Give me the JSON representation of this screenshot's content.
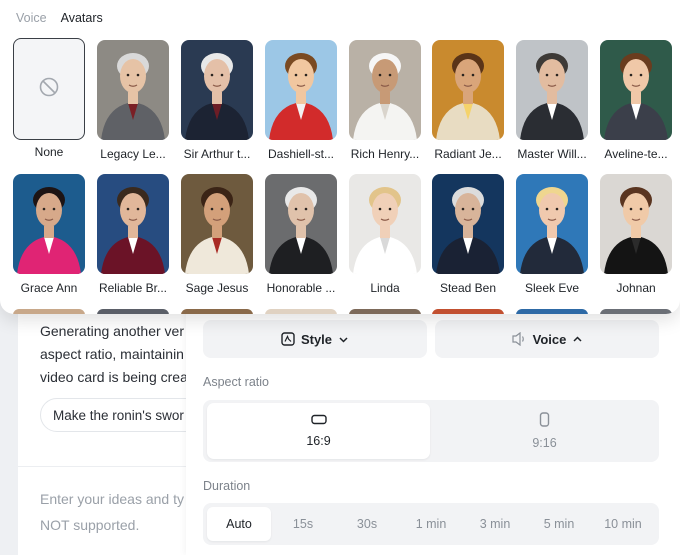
{
  "picker": {
    "tabs": [
      {
        "label": "Voice",
        "active": false
      },
      {
        "label": "Avatars",
        "active": true
      }
    ],
    "none_label": "None",
    "avatars_row1": [
      {
        "name": "Legacy Le...",
        "bg": "#8d8a84",
        "skin": "#e6c3a6",
        "hair": "#d9d9d9",
        "outfit": "#5f6166",
        "accent": "#7a1f25"
      },
      {
        "name": "Sir Arthur t...",
        "bg": "#2a3a52",
        "skin": "#e4c0a8",
        "hair": "#e8e8e8",
        "outfit": "#1c2333",
        "accent": "#6d1d26"
      },
      {
        "name": "Dashiell-st...",
        "bg": "#9cc7e6",
        "skin": "#f1c7a0",
        "hair": "#7a4a22",
        "outfit": "#d22b2b",
        "accent": "#f2f2f2"
      },
      {
        "name": "Rich Henry...",
        "bg": "#b9b1a6",
        "skin": "#c79a76",
        "hair": "#f6f6f6",
        "outfit": "#f4f4f2",
        "accent": "#d9d4cc"
      },
      {
        "name": "Radiant Je...",
        "bg": "#c98a2e",
        "skin": "#d9a57a",
        "hair": "#5a3418",
        "outfit": "#e8dcc2",
        "accent": "#f5d36b"
      },
      {
        "name": "Master Will...",
        "bg": "#bfc3c7",
        "skin": "#e2bca0",
        "hair": "#3d3a37",
        "outfit": "#2a2d33",
        "accent": "#ffffff"
      },
      {
        "name": "Aveline-te...",
        "bg": "#2f5a4a",
        "skin": "#f0c8a8",
        "hair": "#6a3c1e",
        "outfit": "#3b3f4a",
        "accent": "#ffffff"
      }
    ],
    "avatars_row2": [
      {
        "name": "Grace Ann",
        "bg": "#1d5c8e",
        "skin": "#d7a98a",
        "hair": "#1d1414",
        "outfit": "#e02474",
        "accent": "#ffffff"
      },
      {
        "name": "Reliable Br...",
        "bg": "#274c80",
        "skin": "#e1b79a",
        "hair": "#3a2a1e",
        "outfit": "#6b1327",
        "accent": "#ffffff"
      },
      {
        "name": "Sage Jesus",
        "bg": "#6e5a3e",
        "skin": "#d3a07a",
        "hair": "#3b2416",
        "outfit": "#efe8da",
        "accent": "#a82a24"
      },
      {
        "name": "Honorable ...",
        "bg": "#6b6c6e",
        "skin": "#e0c2ab",
        "hair": "#e9e9e9",
        "outfit": "#1e1f22",
        "accent": "#ffffff"
      },
      {
        "name": "Linda",
        "bg": "#e9e8e6",
        "skin": "#f0d0b8",
        "hair": "#e2c48a",
        "outfit": "#ffffff",
        "accent": "#d9d9d9"
      },
      {
        "name": "Stead Ben",
        "bg": "#14365e",
        "skin": "#d8b49a",
        "hair": "#dcdcdc",
        "outfit": "#1a2234",
        "accent": "#ffffff"
      },
      {
        "name": "Sleek Eve",
        "bg": "#2f78b8",
        "skin": "#f0c9ae",
        "hair": "#efd68f",
        "outfit": "#222a3a",
        "accent": "#ffffff"
      },
      {
        "name": "Johnan",
        "bg": "#dad7d3",
        "skin": "#f0caa8",
        "hair": "#5a3520",
        "outfit": "#141414",
        "accent": "#2b2b2b"
      }
    ],
    "row3_colors": [
      "#c8a88a",
      "#5b5f68",
      "#8a6a4a",
      "#e0d2c2",
      "#7d6a5a",
      "#c25030",
      "#2e6aa6",
      "#6b6f76"
    ]
  },
  "chat": {
    "message_lines": [
      "Generating another ver",
      "aspect ratio, maintainin",
      "video card is being crea"
    ],
    "suggestion": "Make the ronin's swor",
    "input_lines": [
      "Enter your ideas and ty",
      "NOT supported."
    ]
  },
  "settings": {
    "style_label": "Style",
    "voice_label": "Voice",
    "aspect_label": "Aspect ratio",
    "aspect_options": [
      {
        "label": "16:9",
        "selected": true
      },
      {
        "label": "9:16",
        "selected": false
      }
    ],
    "duration_label": "Duration",
    "duration_options": [
      {
        "label": "Auto",
        "selected": true
      },
      {
        "label": "15s",
        "selected": false
      },
      {
        "label": "30s",
        "selected": false
      },
      {
        "label": "1 min",
        "selected": false
      },
      {
        "label": "3 min",
        "selected": false
      },
      {
        "label": "5 min",
        "selected": false
      },
      {
        "label": "10 min",
        "selected": false
      }
    ]
  }
}
